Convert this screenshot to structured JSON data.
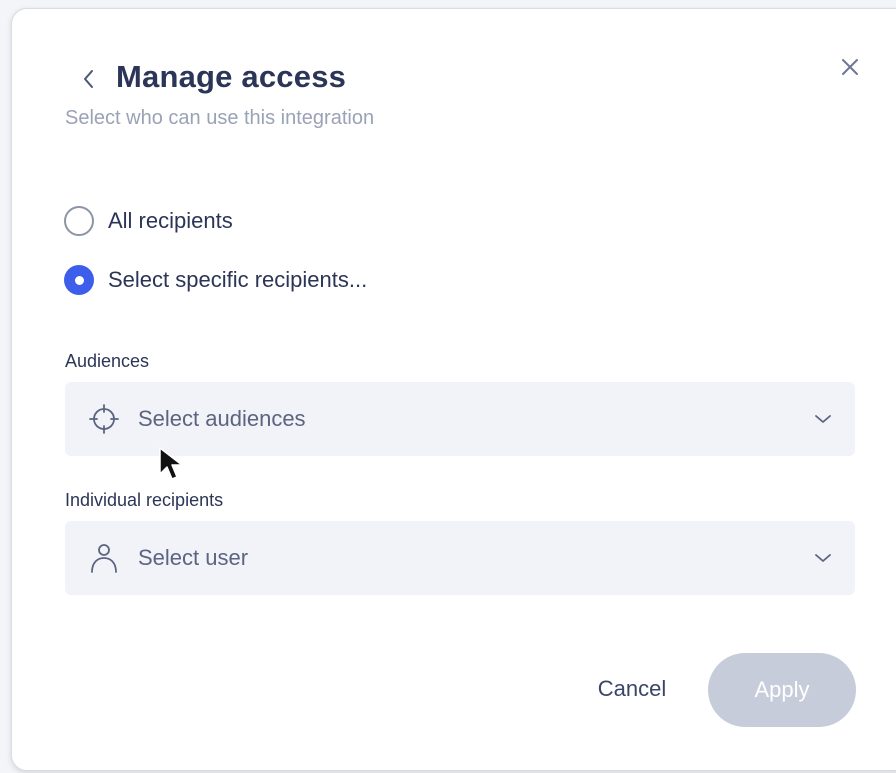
{
  "dialog": {
    "title": "Manage access",
    "subtitle": "Select who can use this integration"
  },
  "options": [
    {
      "label": "All recipients",
      "checked": false
    },
    {
      "label": "Select specific recipients...",
      "checked": true
    }
  ],
  "audiences": {
    "label": "Audiences",
    "placeholder": "Select audiences",
    "icon": "crosshair-icon"
  },
  "individual": {
    "label": "Individual recipients",
    "placeholder": "Select user",
    "icon": "user-icon"
  },
  "footer": {
    "cancel_label": "Cancel",
    "apply_label": "Apply",
    "apply_disabled": true
  },
  "colors": {
    "accent": "#3d5eea",
    "title": "#2b3557",
    "field_bg": "#f2f3f8",
    "apply_disabled_bg": "#c7ccdb"
  }
}
